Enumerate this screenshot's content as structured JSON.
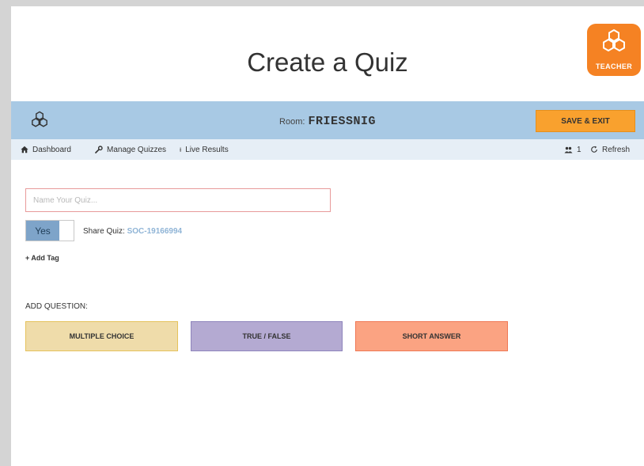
{
  "title_area": {
    "page_title": "Create a Quiz",
    "badge": {
      "icon": "hexagon-cluster-icon",
      "label": "TEACHER",
      "color": "#f58223"
    }
  },
  "top_bar": {
    "logo_icon": "hexagon-cluster-icon",
    "room_label": "Room:",
    "room_name": "FRIESSNIG",
    "save_exit_label": "SAVE & EXIT",
    "bar_color": "#a8c9e4",
    "save_color": "#f9a12e"
  },
  "nav": {
    "dashboard": {
      "icon": "home-icon",
      "label": "Dashboard"
    },
    "manage_quizzes": {
      "icon": "wrench-icon",
      "label": "Manage Quizzes"
    },
    "live_results": {
      "icon": "live-results-icon",
      "label": "Live Results"
    },
    "users": {
      "icon": "users-icon",
      "count": "1"
    },
    "refresh": {
      "icon": "refresh-icon",
      "label": "Refresh"
    }
  },
  "form": {
    "quiz_name": {
      "value": "",
      "placeholder": "Name Your Quiz..."
    },
    "share_toggle": {
      "label": "Yes",
      "state": "on"
    },
    "share_quiz_label": "Share Quiz:",
    "share_code": "SOC-19166994",
    "add_tag_label": "+ Add Tag"
  },
  "add_question": {
    "label": "ADD QUESTION:",
    "buttons": [
      {
        "label": "MULTIPLE CHOICE",
        "color": "#efdcaa"
      },
      {
        "label": "TRUE / FALSE",
        "color": "#b4aad2"
      },
      {
        "label": "SHORT ANSWER",
        "color": "#fba382"
      }
    ]
  }
}
